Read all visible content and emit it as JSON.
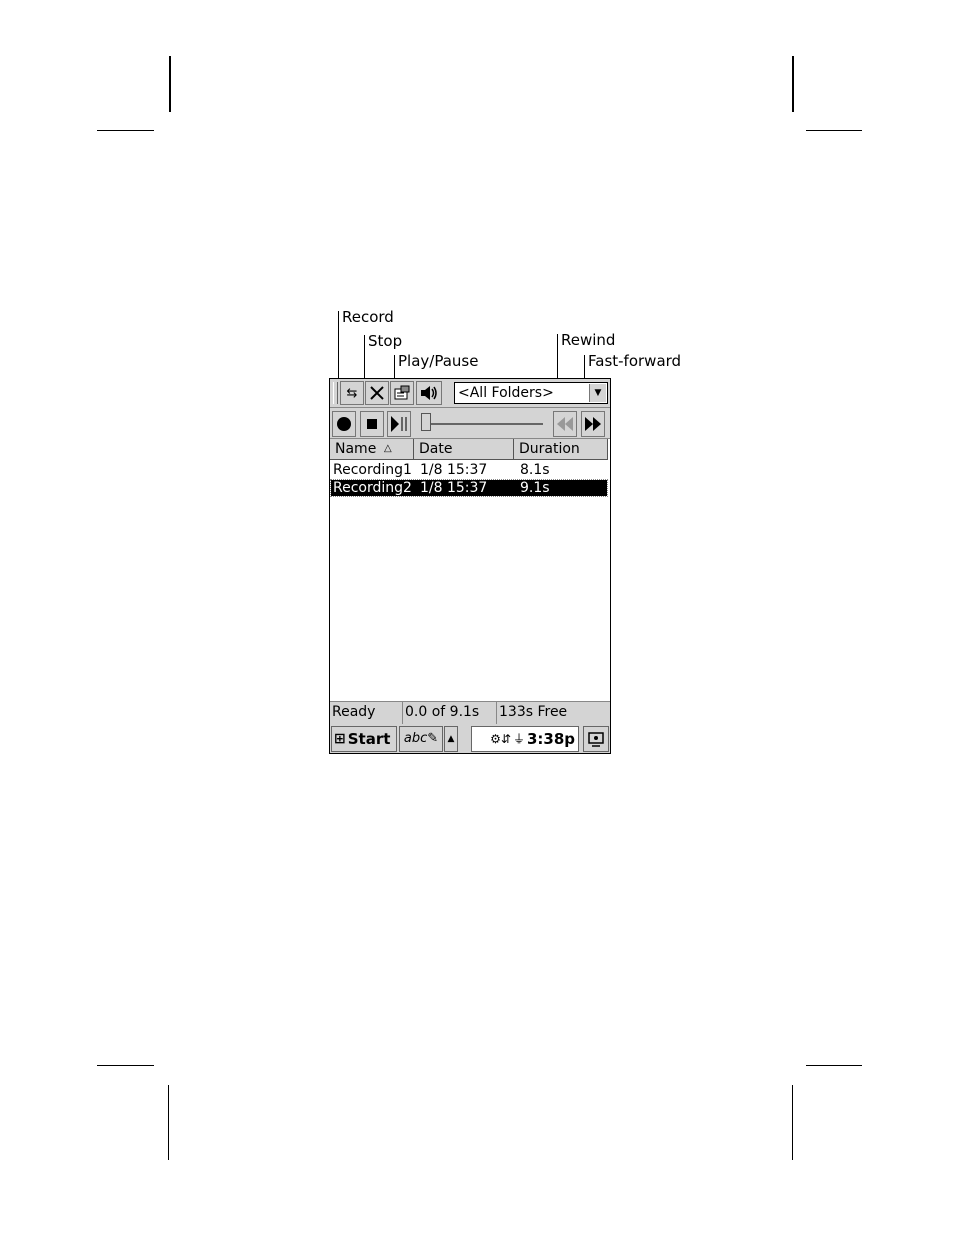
{
  "callouts": {
    "record": "Record",
    "stop": "Stop",
    "play_pause": "Play/Pause",
    "rewind": "Rewind",
    "fast_forward": "Fast-forward"
  },
  "toolbar": {
    "folder_select_value": "<All Folders>"
  },
  "columns": {
    "name": "Name",
    "sort_indicator": "△",
    "date": "Date",
    "duration": "Duration"
  },
  "recordings": [
    {
      "name": "Recording1",
      "date": "1/8 15:37",
      "duration": "8.1s",
      "selected": false
    },
    {
      "name": "Recording2",
      "date": "1/8 15:37",
      "duration": "9.1s",
      "selected": true
    }
  ],
  "status": {
    "state": "Ready",
    "position": "0.0 of 9.1s",
    "free": "133s Free"
  },
  "taskbar": {
    "start_label": "Start",
    "clock": "3:38p"
  },
  "icons": {
    "record": "record-circle-icon",
    "stop": "stop-square-icon",
    "play_pause": "play-pause-icon",
    "rewind": "rewind-icon",
    "fast_forward": "fast-forward-icon",
    "sync": "sync-arrows-icon",
    "delete": "delete-x-icon",
    "properties": "properties-icon",
    "volume": "speaker-icon",
    "dropdown": "chevron-down-icon"
  }
}
